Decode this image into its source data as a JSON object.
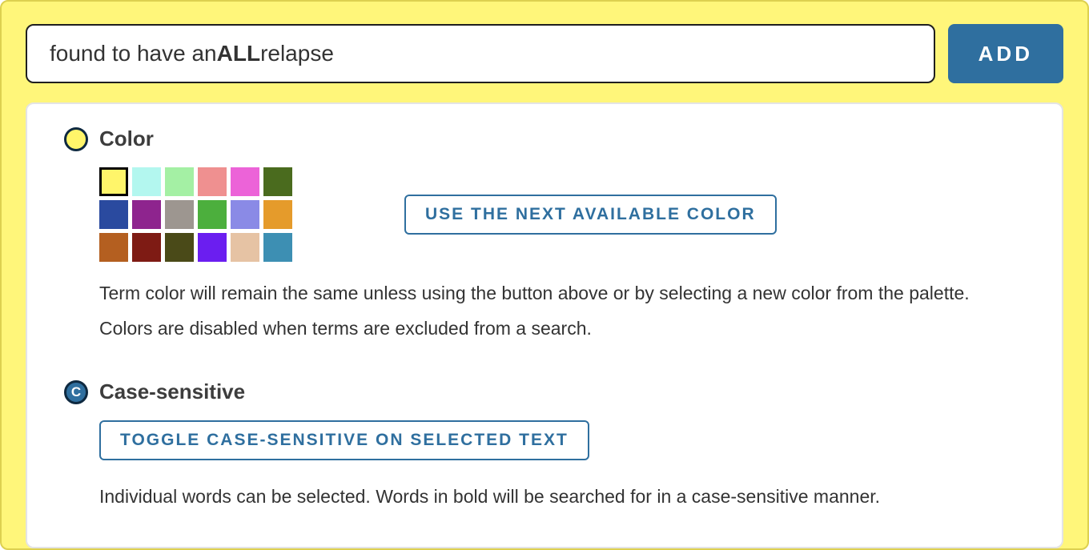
{
  "input": {
    "pre": "found to have an ",
    "bold": "ALL",
    "post": " relapse"
  },
  "addButton": "ADD",
  "colorSection": {
    "title": "Color",
    "nextColorButton": "USE THE NEXT AVAILABLE COLOR",
    "description": "Term color will remain the same unless using the button above or by selecting a new color from the palette. Colors are disabled when terms are excluded from a search.",
    "palette": [
      {
        "hex": "#fff56a",
        "selected": true
      },
      {
        "hex": "#b3f7ef",
        "selected": false
      },
      {
        "hex": "#a4f0a4",
        "selected": false
      },
      {
        "hex": "#ef9090",
        "selected": false
      },
      {
        "hex": "#ec63d8",
        "selected": false
      },
      {
        "hex": "#4a6b1e",
        "selected": false
      },
      {
        "hex": "#2a4a9f",
        "selected": false
      },
      {
        "hex": "#8e248e",
        "selected": false
      },
      {
        "hex": "#9d9690",
        "selected": false
      },
      {
        "hex": "#4caf3d",
        "selected": false
      },
      {
        "hex": "#8a8ae6",
        "selected": false
      },
      {
        "hex": "#e59b2b",
        "selected": false
      },
      {
        "hex": "#b45f20",
        "selected": false
      },
      {
        "hex": "#7e1b14",
        "selected": false
      },
      {
        "hex": "#4a4a18",
        "selected": false
      },
      {
        "hex": "#6b1ef0",
        "selected": false
      },
      {
        "hex": "#e6c3a4",
        "selected": false
      },
      {
        "hex": "#3d8fb3",
        "selected": false
      }
    ]
  },
  "caseSection": {
    "iconLetter": "C",
    "title": "Case-sensitive",
    "toggleButton": "TOGGLE CASE-SENSITIVE ON SELECTED TEXT",
    "description": "Individual words can be selected. Words in bold will be searched for in a case-sensitive manner."
  }
}
